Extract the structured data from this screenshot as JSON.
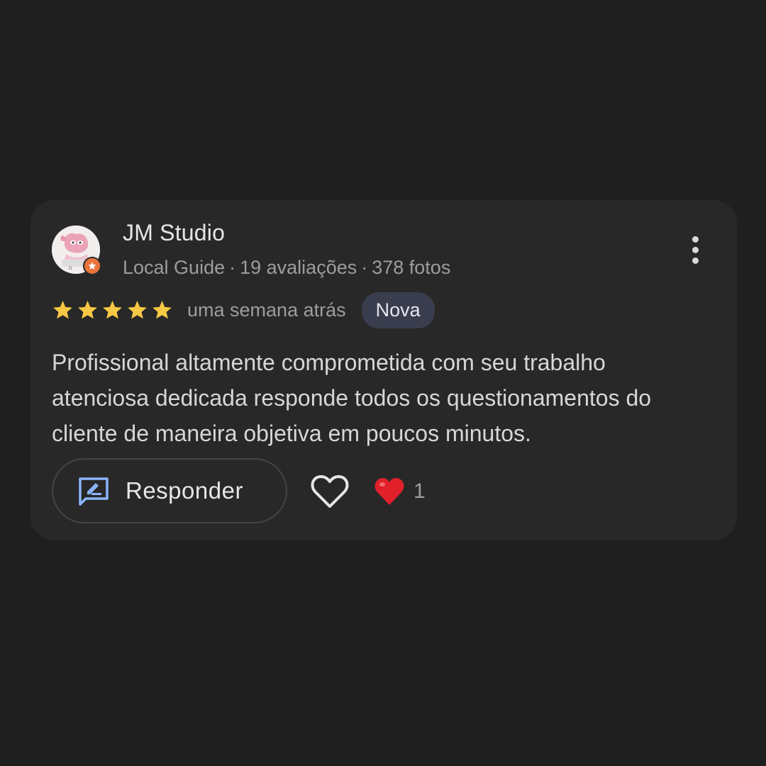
{
  "review": {
    "reviewer_name": "JM Studio",
    "meta": {
      "badge": "Local Guide",
      "reviews": "19 avaliações",
      "photos": "378 fotos",
      "separator": "·"
    },
    "rating": 5,
    "rating_max": 5,
    "time": "uma semana atrás",
    "new_badge": "Nova",
    "text": "Profissional altamente comprometida com seu trabalho atenciosa dedicada responde todos os questionamentos do cliente de maneira objetiva em poucos minutos.",
    "actions": {
      "reply_label": "Responder",
      "like_icon": "heart-outline-icon",
      "reaction_icon": "red-heart-icon",
      "reaction_count": "1"
    }
  },
  "colors": {
    "background": "#1f1f1f",
    "card": "#282828",
    "star": "#f7c843",
    "badge_bg": "#3a3d4d",
    "reply_icon": "#8ab4f8",
    "reaction_heart": "#e0202a",
    "local_guide_badge": "#e8743b"
  }
}
